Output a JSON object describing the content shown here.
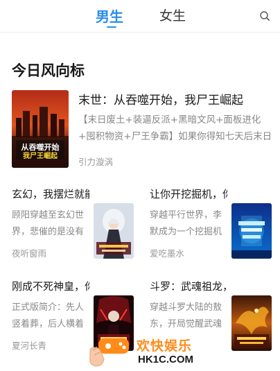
{
  "tabs": {
    "male": "男生",
    "female": "女生"
  },
  "section": {
    "title": "今日风向标"
  },
  "featured": {
    "title": "末世：从吞噬开始，我尸王崛起",
    "description": "【末日废土+装逼反派+黑暗文风+面板进化+囤积物资+尸王争霸】如果你得知七天后末日降临，你会怎么做？",
    "author": "引力漩涡",
    "cover_text": "从吞噬开始我尸王崛起"
  },
  "books": [
    {
      "title": "玄幻，我摆烂就能变强",
      "description": "顾阳穿越至玄幻世界，悲催的是没有系统",
      "author": "夜听窗雨"
    },
    {
      "title": "让你开挖掘机，你挖出神迹",
      "description": "穿越平行世界，李默成为一个挖掘机司机",
      "author": "爱吃墨水"
    },
    {
      "title": "刚成不死神皇，你让我逆袭",
      "description": "正式版简介：先人竖着葬，后人横着出",
      "author": "夏河长青"
    },
    {
      "title": "斗罗：武魂祖龙，我打造最强",
      "description": "穿越斗罗大陆的敖东，开局觉醒武魂祖龙",
      "author": ""
    }
  ],
  "watermark": {
    "text": "欢快娱乐",
    "url": "HK1C.COM"
  },
  "colors": {
    "accent": "#2a8ee8",
    "watermark": "#ff8c1a"
  }
}
